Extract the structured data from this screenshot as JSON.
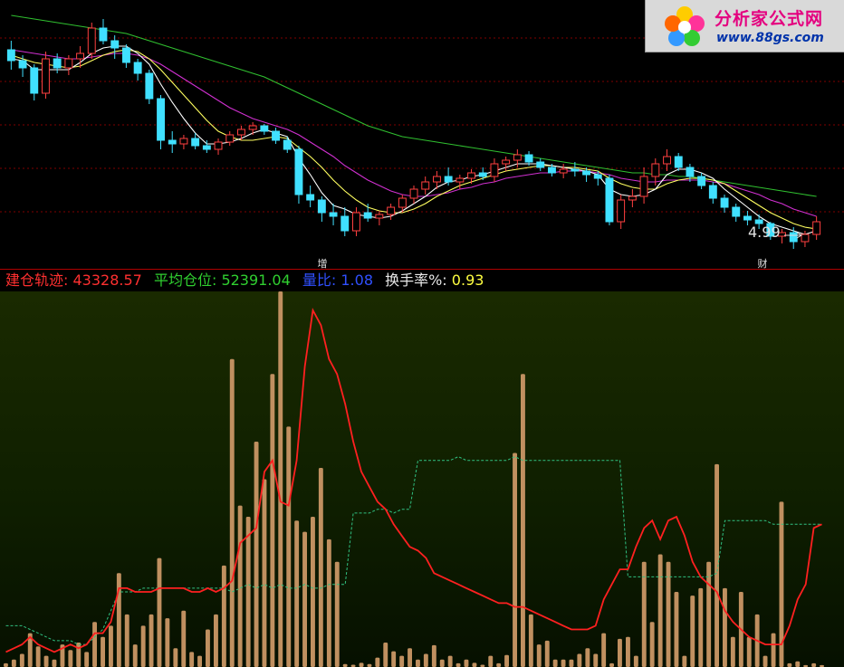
{
  "watermark": {
    "brand": "分析家公式网",
    "url": "www.88gs.com"
  },
  "info_bar": {
    "cost_track_label": "建仓轨迹:",
    "cost_track_value": "43328.57",
    "avg_position_label": "平均仓位:",
    "avg_position_value": "52391.04",
    "volume_ratio_label": "量比:",
    "volume_ratio_value": "1.08",
    "turnover_label": "换手率%:",
    "turnover_value": "0.93"
  },
  "price_panel": {
    "low_price_label": "4.99",
    "markers": [
      "增",
      "财"
    ]
  },
  "colors": {
    "up": "#ff4040",
    "down": "#40e0ff",
    "ma_short": "#ffffff",
    "ma_mid": "#ffff60",
    "ma_long1": "#d030d0",
    "ma_long2": "#30c030",
    "volume_bar": "#c09060",
    "cost_line": "#ff2020",
    "avg_line": "#30c080",
    "grid": "#800000"
  },
  "chart_data": [
    {
      "type": "candlestick",
      "candles": [
        [
          5.85,
          5.9,
          5.74,
          5.79
        ],
        [
          5.79,
          5.82,
          5.7,
          5.75
        ],
        [
          5.75,
          5.77,
          5.57,
          5.61
        ],
        [
          5.61,
          5.84,
          5.58,
          5.8
        ],
        [
          5.8,
          5.83,
          5.72,
          5.75
        ],
        [
          5.75,
          5.82,
          5.71,
          5.8
        ],
        [
          5.8,
          5.87,
          5.75,
          5.83
        ],
        [
          5.83,
          6.0,
          5.8,
          5.97
        ],
        [
          5.97,
          6.02,
          5.88,
          5.9
        ],
        [
          5.9,
          5.93,
          5.8,
          5.86
        ],
        [
          5.86,
          5.88,
          5.75,
          5.78
        ],
        [
          5.78,
          5.8,
          5.68,
          5.72
        ],
        [
          5.72,
          5.74,
          5.55,
          5.58
        ],
        [
          5.58,
          5.6,
          5.3,
          5.35
        ],
        [
          5.35,
          5.4,
          5.28,
          5.33
        ],
        [
          5.33,
          5.38,
          5.3,
          5.36
        ],
        [
          5.36,
          5.39,
          5.3,
          5.32
        ],
        [
          5.32,
          5.35,
          5.28,
          5.3
        ],
        [
          5.3,
          5.36,
          5.27,
          5.34
        ],
        [
          5.34,
          5.4,
          5.32,
          5.38
        ],
        [
          5.38,
          5.43,
          5.35,
          5.41
        ],
        [
          5.41,
          5.45,
          5.38,
          5.43
        ],
        [
          5.43,
          5.44,
          5.38,
          5.4
        ],
        [
          5.4,
          5.42,
          5.33,
          5.35
        ],
        [
          5.35,
          5.37,
          5.28,
          5.3
        ],
        [
          5.3,
          5.32,
          5.0,
          5.05
        ],
        [
          5.05,
          5.1,
          4.98,
          5.02
        ],
        [
          5.02,
          5.04,
          4.9,
          4.95
        ],
        [
          4.95,
          5.0,
          4.88,
          4.93
        ],
        [
          4.93,
          4.98,
          4.82,
          4.85
        ],
        [
          4.85,
          4.98,
          4.82,
          4.95
        ],
        [
          4.95,
          5.0,
          4.9,
          4.92
        ],
        [
          4.92,
          4.96,
          4.88,
          4.94
        ],
        [
          4.94,
          5.0,
          4.91,
          4.98
        ],
        [
          4.98,
          5.05,
          4.95,
          5.03
        ],
        [
          5.03,
          5.1,
          5.0,
          5.08
        ],
        [
          5.08,
          5.15,
          5.05,
          5.12
        ],
        [
          5.12,
          5.18,
          5.08,
          5.15
        ],
        [
          5.15,
          5.2,
          5.1,
          5.12
        ],
        [
          5.12,
          5.16,
          5.08,
          5.14
        ],
        [
          5.14,
          5.19,
          5.11,
          5.17
        ],
        [
          5.17,
          5.2,
          5.13,
          5.15
        ],
        [
          5.15,
          5.25,
          5.12,
          5.22
        ],
        [
          5.22,
          5.26,
          5.18,
          5.24
        ],
        [
          5.24,
          5.3,
          5.2,
          5.27
        ],
        [
          5.27,
          5.29,
          5.21,
          5.23
        ],
        [
          5.23,
          5.25,
          5.18,
          5.2
        ],
        [
          5.2,
          5.22,
          5.15,
          5.17
        ],
        [
          5.17,
          5.22,
          5.14,
          5.19
        ],
        [
          5.19,
          5.23,
          5.15,
          5.18
        ],
        [
          5.18,
          5.2,
          5.12,
          5.16
        ],
        [
          5.16,
          5.18,
          5.1,
          5.14
        ],
        [
          5.14,
          5.16,
          4.88,
          4.9
        ],
        [
          4.9,
          5.05,
          4.86,
          5.02
        ],
        [
          5.02,
          5.08,
          4.98,
          5.04
        ],
        [
          5.04,
          5.2,
          5.0,
          5.15
        ],
        [
          5.15,
          5.25,
          5.1,
          5.22
        ],
        [
          5.22,
          5.3,
          5.18,
          5.26
        ],
        [
          5.26,
          5.28,
          5.18,
          5.2
        ],
        [
          5.2,
          5.22,
          5.12,
          5.15
        ],
        [
          5.15,
          5.17,
          5.08,
          5.1
        ],
        [
          5.1,
          5.12,
          5.0,
          5.03
        ],
        [
          5.03,
          5.05,
          4.95,
          4.98
        ],
        [
          4.98,
          5.0,
          4.9,
          4.93
        ],
        [
          4.93,
          4.96,
          4.88,
          4.91
        ],
        [
          4.91,
          4.94,
          4.86,
          4.89
        ],
        [
          4.89,
          4.9,
          4.8,
          4.82
        ],
        [
          4.82,
          4.86,
          4.78,
          4.84
        ],
        [
          4.84,
          4.87,
          4.75,
          4.79
        ],
        [
          4.79,
          4.85,
          4.76,
          4.83
        ],
        [
          4.83,
          4.93,
          4.8,
          4.9
        ]
      ],
      "ma_short": [
        5.8,
        5.79,
        5.74,
        5.74,
        5.74,
        5.74,
        5.78,
        5.83,
        5.86,
        5.87,
        5.87,
        5.83,
        5.77,
        5.66,
        5.56,
        5.47,
        5.39,
        5.33,
        5.33,
        5.34,
        5.36,
        5.39,
        5.41,
        5.39,
        5.37,
        5.25,
        5.16,
        5.06,
        4.99,
        4.97,
        4.94,
        4.93,
        4.92,
        4.93,
        4.96,
        5.0,
        5.04,
        5.09,
        5.12,
        5.13,
        5.15,
        5.16,
        5.18,
        5.2,
        5.22,
        5.22,
        5.22,
        5.21,
        5.2,
        5.19,
        5.18,
        5.16,
        5.08,
        5.05,
        5.04,
        5.05,
        5.08,
        5.16,
        5.19,
        5.19,
        5.17,
        5.14,
        5.08,
        5.03,
        4.98,
        4.93,
        4.89,
        4.87,
        4.85,
        4.83,
        4.85
      ],
      "ma_mid": [
        5.82,
        5.8,
        5.78,
        5.77,
        5.76,
        5.75,
        5.76,
        5.79,
        5.82,
        5.84,
        5.85,
        5.84,
        5.8,
        5.74,
        5.67,
        5.6,
        5.53,
        5.46,
        5.4,
        5.37,
        5.35,
        5.35,
        5.36,
        5.37,
        5.36,
        5.31,
        5.26,
        5.2,
        5.13,
        5.07,
        5.02,
        4.98,
        4.96,
        4.95,
        4.95,
        4.97,
        5.0,
        5.04,
        5.07,
        5.1,
        5.12,
        5.14,
        5.16,
        5.18,
        5.19,
        5.2,
        5.21,
        5.21,
        5.2,
        5.2,
        5.19,
        5.18,
        5.14,
        5.11,
        5.09,
        5.08,
        5.08,
        5.11,
        5.13,
        5.14,
        5.14,
        5.13,
        5.11,
        5.07,
        5.03,
        4.99,
        4.95,
        4.92,
        4.89,
        4.87,
        4.86
      ],
      "ma_long1": [
        5.85,
        5.84,
        5.83,
        5.82,
        5.81,
        5.8,
        5.8,
        5.81,
        5.82,
        5.83,
        5.83,
        5.82,
        5.8,
        5.77,
        5.73,
        5.69,
        5.65,
        5.61,
        5.57,
        5.53,
        5.5,
        5.47,
        5.45,
        5.43,
        5.41,
        5.38,
        5.34,
        5.3,
        5.26,
        5.21,
        5.17,
        5.13,
        5.1,
        5.07,
        5.05,
        5.04,
        5.04,
        5.05,
        5.06,
        5.08,
        5.09,
        5.11,
        5.12,
        5.14,
        5.15,
        5.16,
        5.17,
        5.17,
        5.18,
        5.18,
        5.18,
        5.17,
        5.16,
        5.14,
        5.13,
        5.12,
        5.12,
        5.13,
        5.13,
        5.13,
        5.13,
        5.12,
        5.11,
        5.09,
        5.07,
        5.05,
        5.02,
        5.0,
        4.97,
        4.95,
        4.93
      ],
      "ma_long2": [
        6.04,
        6.03,
        6.02,
        6.01,
        6.0,
        5.99,
        5.98,
        5.97,
        5.96,
        5.95,
        5.94,
        5.92,
        5.9,
        5.88,
        5.86,
        5.84,
        5.82,
        5.8,
        5.78,
        5.76,
        5.74,
        5.72,
        5.7,
        5.67,
        5.64,
        5.61,
        5.58,
        5.55,
        5.52,
        5.49,
        5.46,
        5.43,
        5.41,
        5.39,
        5.37,
        5.36,
        5.35,
        5.34,
        5.33,
        5.32,
        5.31,
        5.3,
        5.29,
        5.28,
        5.27,
        5.26,
        5.25,
        5.24,
        5.23,
        5.22,
        5.21,
        5.2,
        5.19,
        5.18,
        5.17,
        5.17,
        5.16,
        5.16,
        5.15,
        5.15,
        5.14,
        5.13,
        5.12,
        5.11,
        5.1,
        5.09,
        5.08,
        5.07,
        5.06,
        5.05,
        5.04
      ],
      "ylim": [
        4.7,
        6.1
      ]
    },
    {
      "type": "bar",
      "volumes": [
        1.0,
        2.0,
        3.5,
        9.0,
        5.5,
        3.0,
        2.0,
        6.0,
        4.5,
        6.5,
        4.0,
        12.0,
        8.0,
        11.0,
        25.0,
        14.0,
        6.0,
        11.0,
        14.0,
        29.0,
        13.0,
        5.0,
        15.0,
        4.0,
        3.0,
        10.0,
        14.0,
        27.0,
        82.0,
        43.0,
        40.0,
        60.0,
        50.0,
        78.0,
        100.0,
        64.0,
        39.0,
        36.0,
        40.0,
        53.0,
        34.0,
        28.0,
        0.8,
        0.6,
        1.1,
        0.8,
        2.5,
        6.5,
        4.2,
        3.0,
        5.0,
        2.0,
        3.5,
        5.8,
        2.0,
        3.0,
        1.0,
        2.0,
        1.1,
        0.6,
        3.0,
        1.0,
        3.2,
        57.0,
        78.0,
        14.0,
        6.0,
        7.0,
        2.0,
        2.0,
        2.0,
        3.5,
        5.0,
        3.5,
        9.0,
        1.0,
        7.5,
        8.0,
        3.0,
        28.0,
        12.0,
        30.0,
        28.0,
        20.0,
        3.0,
        19.0,
        21.0,
        28.0,
        54.0,
        21.0,
        8.0,
        20.0,
        8.0,
        14.0,
        3.0,
        9.0,
        44.0,
        1.0,
        1.5,
        0.5,
        1.0,
        0.5
      ],
      "cost_line": [
        4,
        5,
        6,
        8,
        6,
        5,
        4,
        5,
        6,
        5,
        6,
        9,
        9,
        12,
        21,
        21,
        20,
        20,
        20,
        21,
        21,
        21,
        21,
        20,
        20,
        21,
        20,
        21,
        23,
        33,
        35,
        37,
        52,
        55,
        44,
        43,
        55,
        80,
        95,
        91,
        82,
        78,
        70,
        60,
        52,
        48,
        44,
        42,
        38,
        35,
        32,
        31,
        29,
        25,
        24,
        23,
        22,
        21,
        20,
        19,
        18,
        17,
        17,
        16,
        16,
        15,
        14,
        13,
        12,
        11,
        10,
        10,
        10,
        11,
        18,
        22,
        26,
        26,
        32,
        37,
        39,
        34,
        39,
        40,
        35,
        28,
        24,
        22,
        20,
        15,
        12,
        10,
        8,
        7,
        6,
        6,
        6,
        11,
        18,
        22,
        37,
        38
      ],
      "avg_line": [
        11,
        11,
        11,
        10,
        9,
        8,
        7,
        7,
        7,
        6,
        6,
        8,
        10,
        15,
        20,
        20,
        20,
        21,
        21,
        21,
        21,
        21,
        21,
        21,
        21,
        21,
        21,
        21,
        20,
        21,
        22,
        21,
        22,
        21,
        22,
        21,
        21,
        22,
        21,
        21,
        22,
        22,
        22,
        41,
        41,
        41,
        42,
        42,
        41,
        42,
        42,
        55,
        55,
        55,
        55,
        55,
        56,
        55,
        55,
        55,
        55,
        55,
        55,
        56,
        55,
        55,
        55,
        55,
        55,
        55,
        55,
        55,
        55,
        55,
        55,
        55,
        55,
        24,
        24,
        24,
        24,
        24,
        24,
        24,
        24,
        24,
        24,
        24,
        25,
        39,
        39,
        39,
        39,
        39,
        39,
        38,
        38,
        38,
        38,
        38,
        38,
        38
      ],
      "ylim": [
        0,
        100
      ]
    }
  ]
}
